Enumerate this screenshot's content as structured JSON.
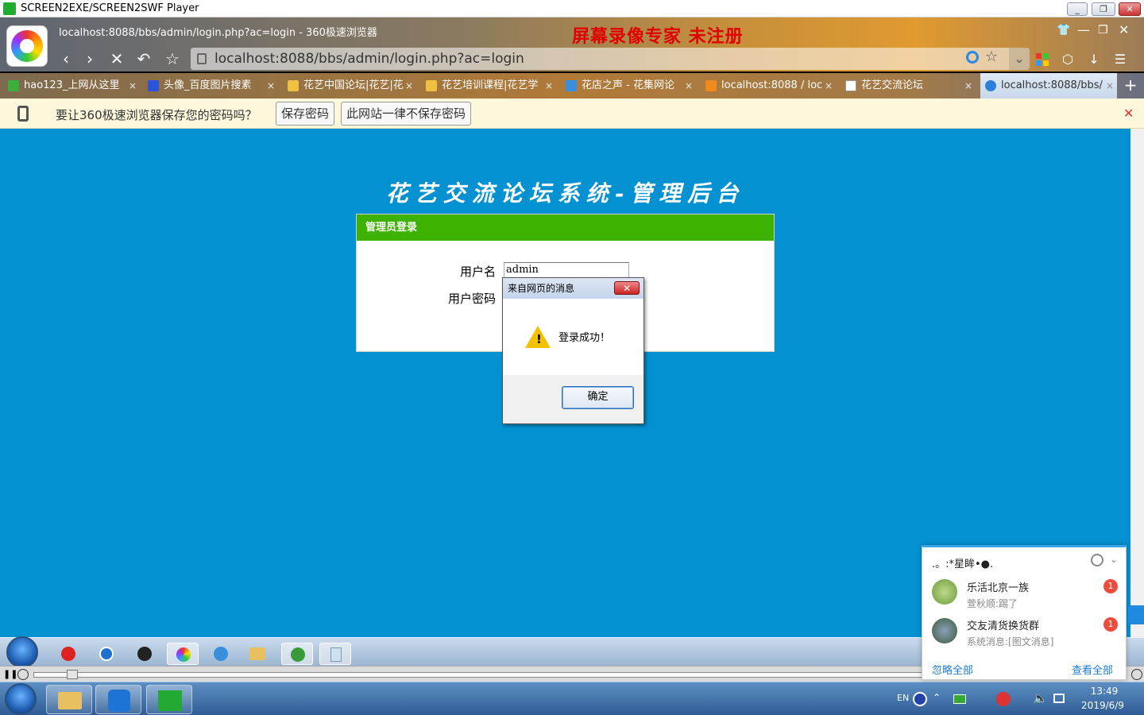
{
  "player": {
    "title": "SCREEN2EXE/SCREEN2SWF Player"
  },
  "browser": {
    "title": "localhost:8088/bbs/admin/login.php?ac=login - 360极速浏览器",
    "watermark": "屏幕录像专家  未注册",
    "address": "localhost:8088/bbs/admin/login.php?ac=login",
    "tabs": [
      {
        "label": "hao123_上网从这里",
        "color": "#3cae3c"
      },
      {
        "label": "头像_百度图片搜素",
        "color": "#2b54d9"
      },
      {
        "label": "花艺中国论坛|花艺|花",
        "color": "#f0c040"
      },
      {
        "label": "花艺培训课程|花艺学",
        "color": "#f0c040"
      },
      {
        "label": "花店之声 - 花集网论",
        "color": "#3a8ede"
      },
      {
        "label": "localhost:8088 / loc",
        "color": "#f08a1e"
      },
      {
        "label": "花艺交流论坛",
        "color": "#ffffff"
      },
      {
        "label": "localhost:8088/bbs/",
        "color": "#2e7fd8"
      }
    ],
    "tab_close": "×",
    "new_tab": "+"
  },
  "password_bar": {
    "message": "要让360极速浏览器保存您的密码吗？",
    "save_label": "保存密码",
    "never_label": "此网站一律不保存密码",
    "close": "✕"
  },
  "page": {
    "site_title": "花艺交流论坛系统-管理后台",
    "login_header": "管理员登录",
    "username_label": "用户名",
    "username_value": "admin",
    "password_label": "用户密码"
  },
  "alert": {
    "title": "来自网页的消息",
    "close": "✕",
    "message": "登录成功！",
    "warning_mark": "!",
    "ok_label": "确定"
  },
  "qq_popup": {
    "nickname": ".。:*星眸•●.",
    "items": [
      {
        "name": "乐活北京一族",
        "sub": "萱秋顺:踢了",
        "badge": "1"
      },
      {
        "name": "交友清货换货群",
        "sub": "系统消息:[图文消息]",
        "badge": "1"
      }
    ],
    "ignore_all": "忽略全部",
    "view_all": "查看全部"
  },
  "tray": {
    "lang": "EN",
    "time": "13:49",
    "date": "2019/6/9"
  }
}
